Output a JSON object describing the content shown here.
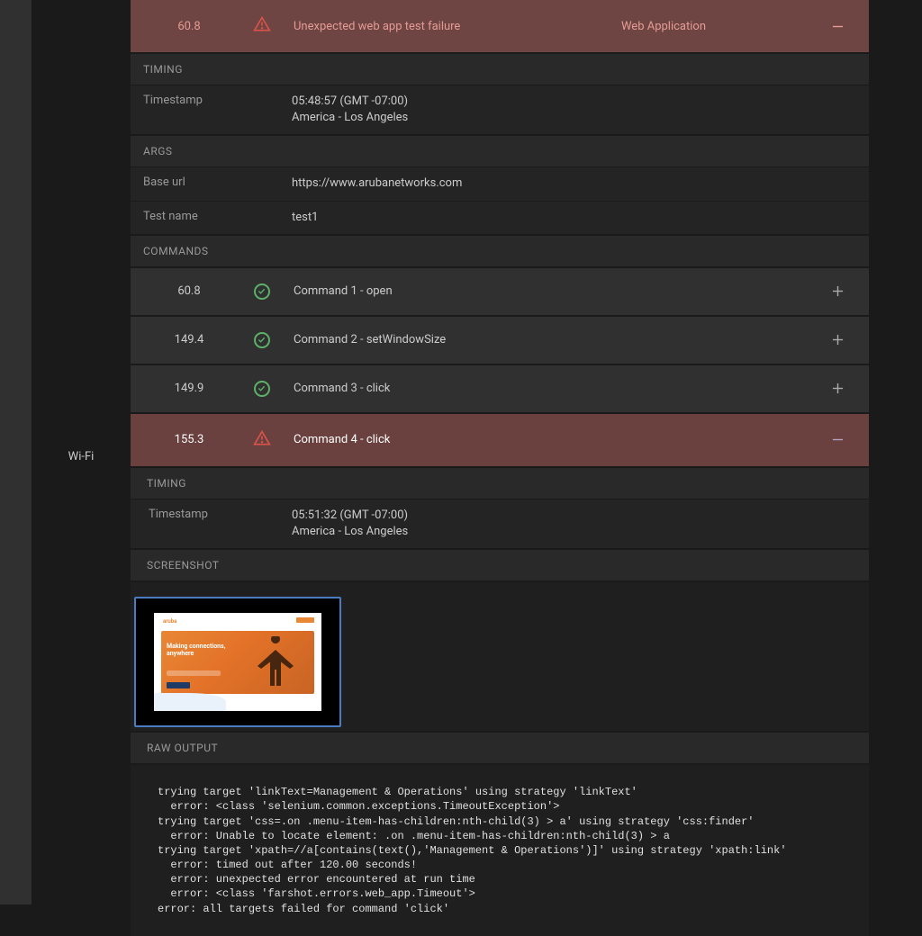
{
  "sidebar": {
    "label": "Wi-Fi"
  },
  "header": {
    "time": "60.8",
    "message": "Unexpected web app test failure",
    "category": "Web Application"
  },
  "sections": {
    "timing_label": "TIMING",
    "args_label": "ARGS",
    "commands_label": "COMMANDS",
    "screenshot_label": "SCREENSHOT",
    "raw_output_label": "RAW OUTPUT",
    "timestamp_key": "Timestamp",
    "timestamp_val_line1": "05:48:57 (GMT -07:00)",
    "timestamp_val_line2": "America - Los Angeles",
    "baseurl_key": "Base url",
    "baseurl_val": "https://www.arubanetworks.com",
    "testname_key": "Test name",
    "testname_val": "test1"
  },
  "commands": [
    {
      "time": "60.8",
      "label": "Command 1 - open",
      "status": "ok"
    },
    {
      "time": "149.4",
      "label": "Command 2 - setWindowSize",
      "status": "ok"
    },
    {
      "time": "149.9",
      "label": "Command 3 - click",
      "status": "ok"
    },
    {
      "time": "155.3",
      "label": "Command 4 - click",
      "status": "error"
    }
  ],
  "command4_detail": {
    "timing_label": "TIMING",
    "timestamp_key": "Timestamp",
    "timestamp_val_line1": "05:51:32 (GMT -07:00)",
    "timestamp_val_line2": "America - Los Angeles"
  },
  "raw_output": "trying target 'linkText=Management & Operations' using strategy 'linkText'\n  error: <class 'selenium.common.exceptions.TimeoutException'>\ntrying target 'css=.on .menu-item-has-children:nth-child(3) > a' using strategy 'css:finder'\n  error: Unable to locate element: .on .menu-item-has-children:nth-child(3) > a\ntrying target 'xpath=//a[contains(text(),'Management & Operations')]' using strategy 'xpath:link'\n  error: timed out after 120.00 seconds!\n  error: unexpected error encountered at run time\n  error: <class 'farshot.errors.web_app.Timeout'>\nerror: all targets failed for command 'click'",
  "thumb": {
    "brand": "aruba",
    "headline1": "Making connections,",
    "headline2": "anywhere"
  }
}
